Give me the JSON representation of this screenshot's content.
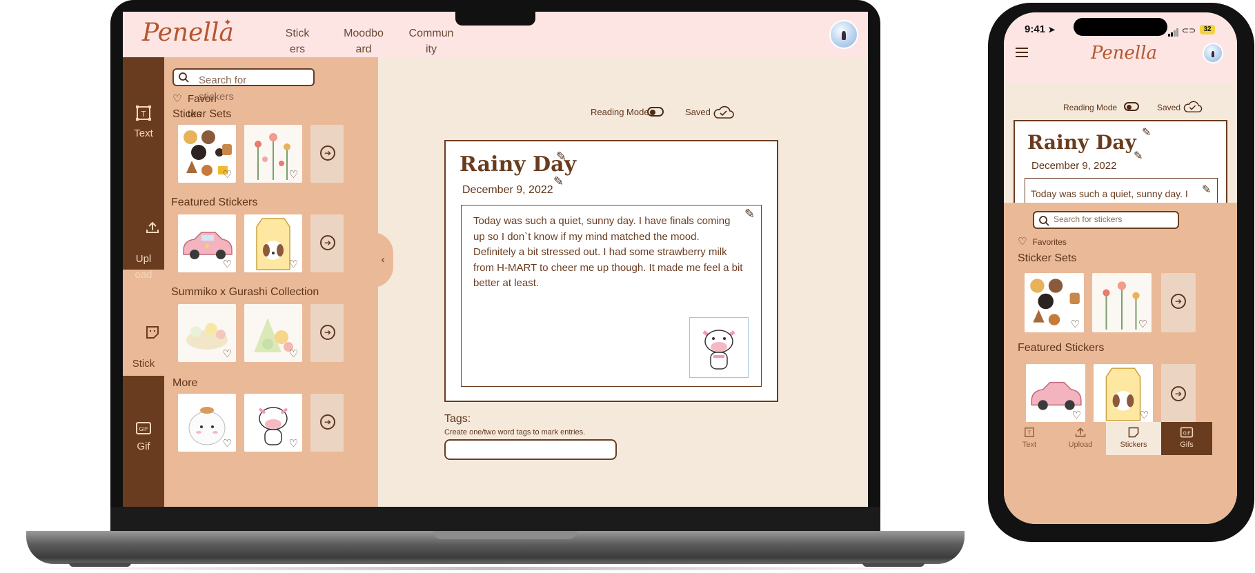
{
  "laptop": {
    "brand": "Penella",
    "nav": [
      "Stick\ners",
      "Moodbo\nard",
      "Commun\nity"
    ],
    "rail": [
      "Text",
      "Upl\noad",
      "Stick\ners",
      "Gif"
    ],
    "search": {
      "placeholder": "Search for\nstickers"
    },
    "favorites": "Favori\ntes",
    "sections": [
      "Sticker Sets",
      "Featured Stickers",
      "Summiko x Gurashi Collection",
      "More"
    ],
    "reading_mode": "Reading Mode",
    "saved": "Saved",
    "entry": {
      "title": "Rainy Day",
      "date": "December 9, 2022",
      "body": "Today was such a quiet, sunny day. I have finals coming up so I don`t know if my mind matched the mood. Definitely a bit stressed out. I had some strawberry milk from H-MART to cheer me up though. It made me feel a bit better at least."
    },
    "tags": {
      "label": "Tags:",
      "hint": "Create one/two word tags to mark entries."
    }
  },
  "phone": {
    "time": "9:41",
    "battery": "32",
    "brand": "Penella",
    "reading_mode": "Reading Mode",
    "saved": "Saved",
    "entry": {
      "title": "Rainy Day",
      "date": "December 9, 2022",
      "body": "Today was such a quiet, sunny day. I have finals"
    },
    "search": {
      "placeholder": "Search for stickers"
    },
    "favorites": "Favorites",
    "sections": [
      "Sticker Sets",
      "Featured Stickers"
    ],
    "tabs": [
      "Text",
      "Upload",
      "Stickers",
      "Gifs"
    ]
  },
  "icons": [
    "text-icon",
    "upload-icon",
    "sticker-icon",
    "gif-icon",
    "search-icon",
    "heart-icon",
    "arrow-right-circle-icon",
    "pencil-icon",
    "cloud-check-icon",
    "chevron-left-icon",
    "hamburger-menu-icon"
  ],
  "colors": {
    "brown": "#6a3c1f",
    "peach": "#eab998",
    "cream": "#f5e9dc",
    "pink": "#fde5e4",
    "logo": "#b4562e"
  }
}
